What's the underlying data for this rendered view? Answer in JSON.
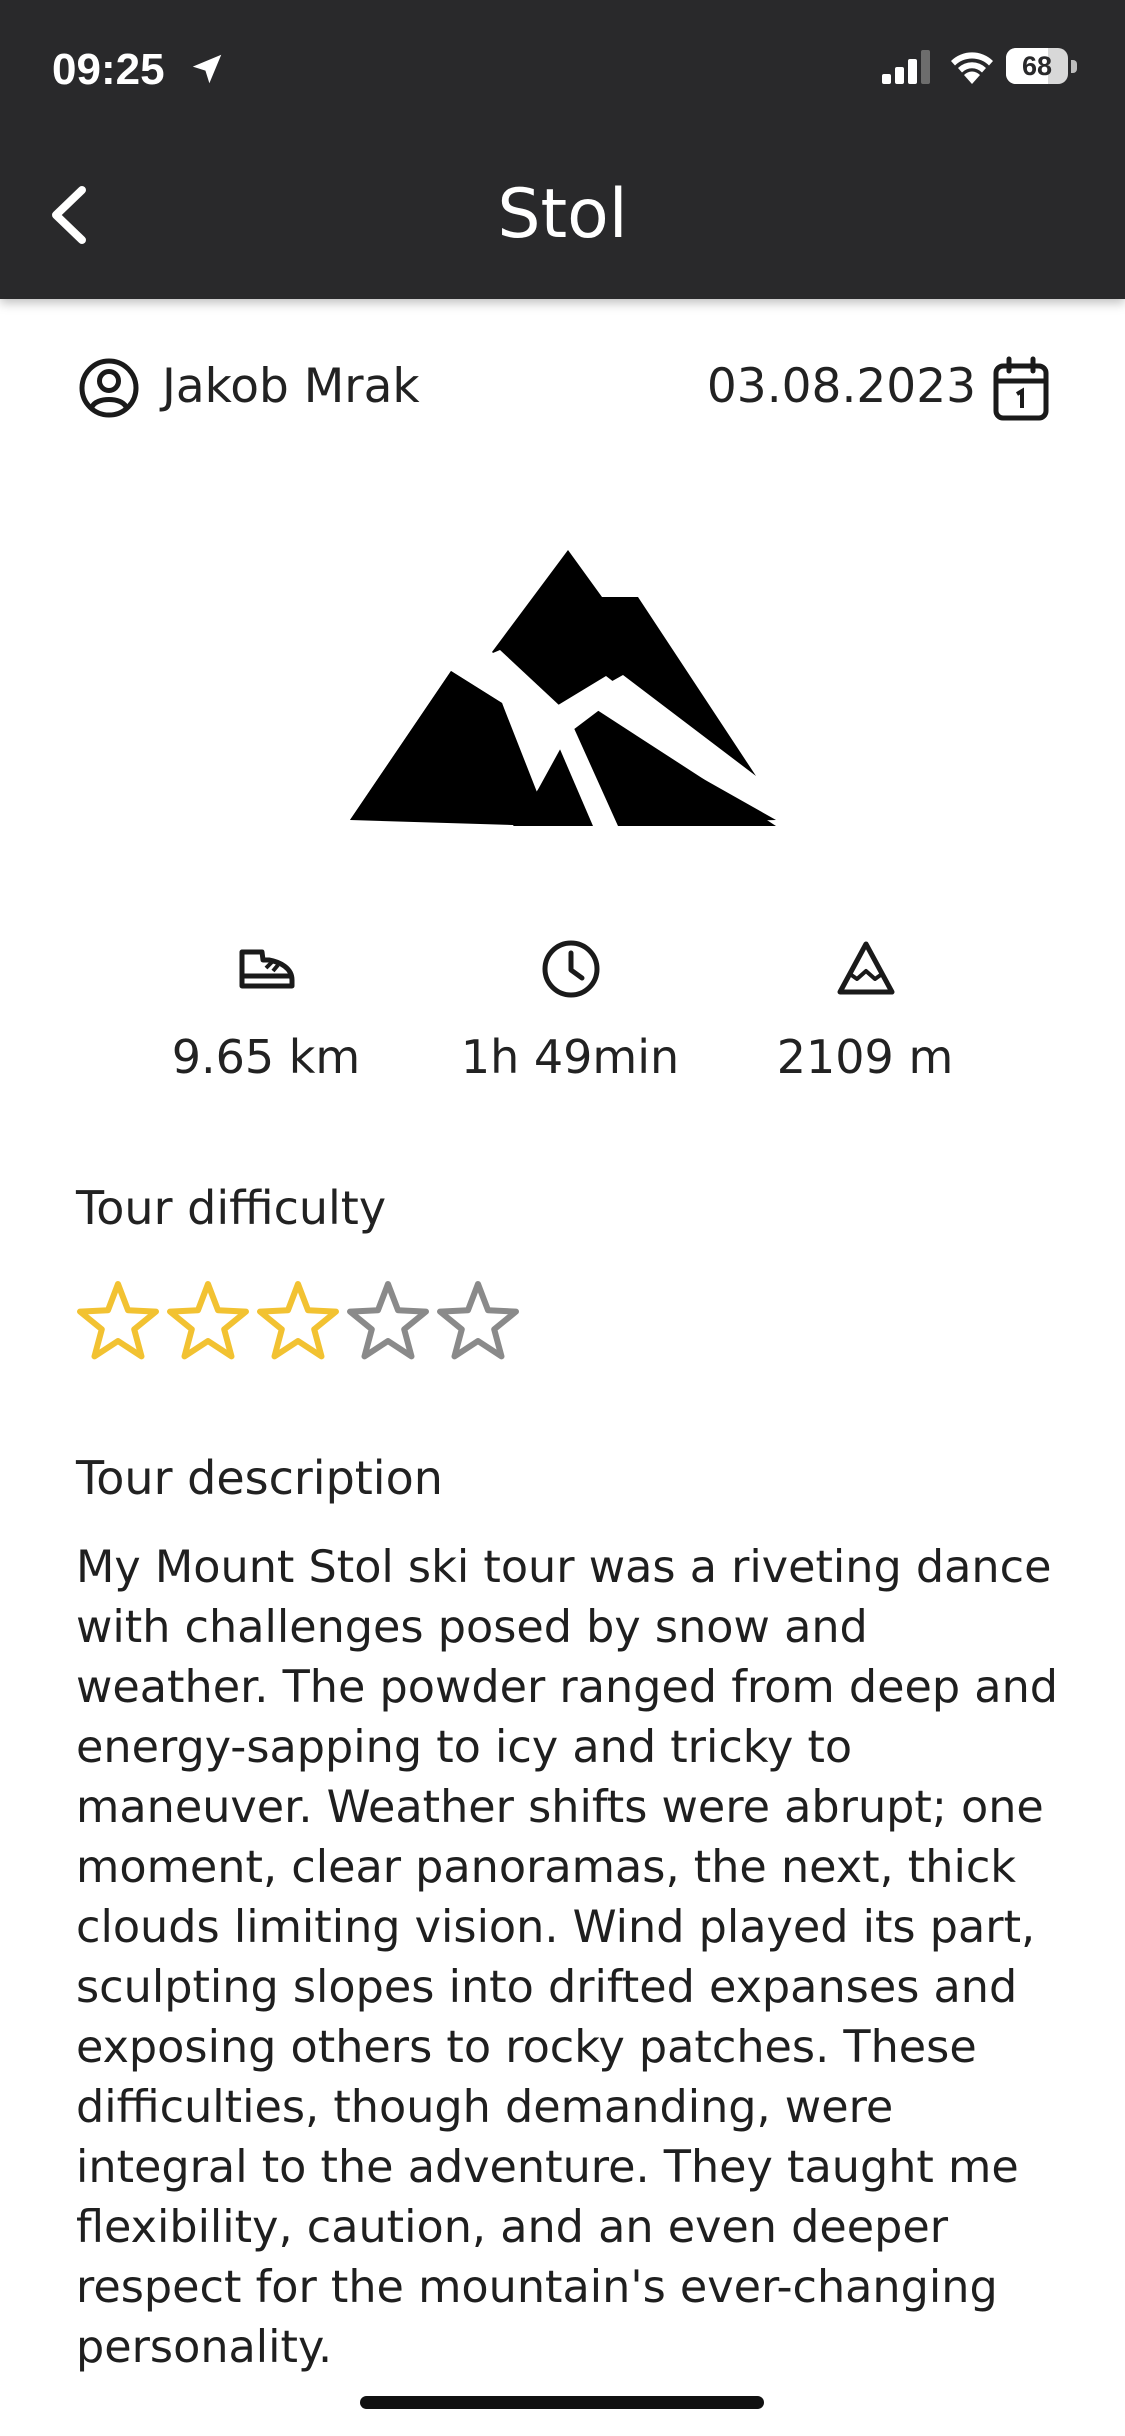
{
  "status_bar": {
    "time": "09:25",
    "battery_level": "68",
    "battery_fraction": 0.68,
    "icons": [
      "location-arrow-icon",
      "cellular-signal-icon",
      "wifi-icon",
      "battery-icon"
    ]
  },
  "header": {
    "title": "Stol",
    "back_icon": "chevron-left-icon"
  },
  "tour": {
    "author": "Jakob Mrak",
    "author_icon": "user-circle-icon",
    "date": "03.08.2023",
    "date_icon": "calendar-icon",
    "hero_icon": "mountain-icon"
  },
  "stats": {
    "distance": {
      "value": "9.65 km",
      "icon": "shoe-icon"
    },
    "duration": {
      "value": "1h 49min",
      "icon": "clock-icon"
    },
    "elevation": {
      "value": "2109 m",
      "icon": "mountain-peak-icon"
    }
  },
  "difficulty": {
    "heading": "Tour difficulty",
    "rating": 3,
    "max": 5
  },
  "description": {
    "heading": "Tour description",
    "text": "My Mount Stol ski tour was a riveting dance with challenges posed by snow and weather. The powder ranged from deep and energy-sapping to icy and tricky to maneuver. Weather shifts were abrupt; one moment, clear panoramas, the next, thick clouds limiting vision. Wind played its part, sculpting slopes into drifted expanses and exposing others to rocky patches. These difficulties, though demanding, were integral to the adventure. They taught me flexibility, caution, and an even deeper respect for the mountain's ever-changing personality."
  },
  "colors": {
    "header_background": "#29292b",
    "star_filled": "#f2c232",
    "star_empty": "#8a8a8a",
    "text": "#1f1f1f"
  }
}
